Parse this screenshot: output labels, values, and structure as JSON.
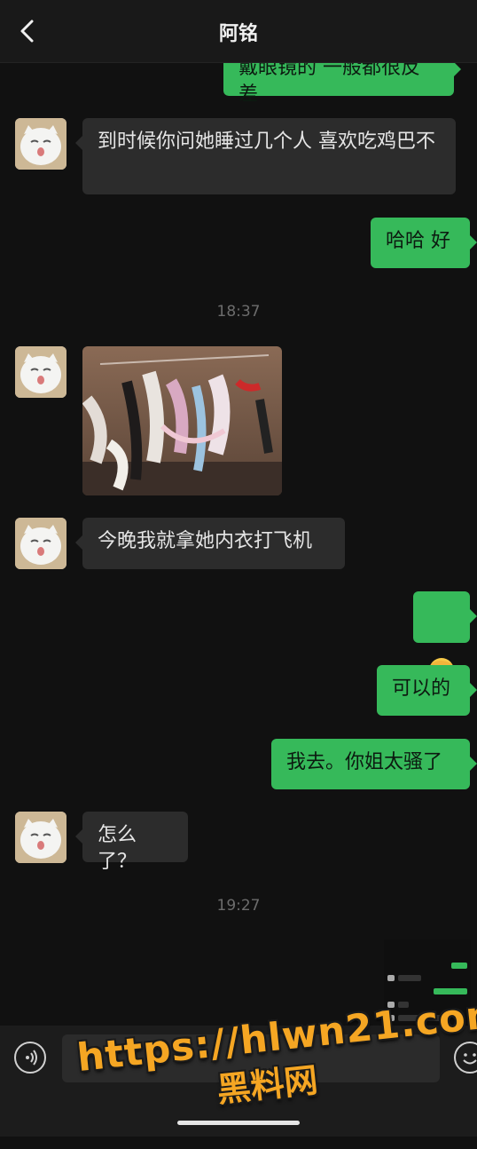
{
  "header": {
    "title": "阿铭"
  },
  "messages": [
    {
      "side": "right",
      "text": "戴眼镜的 一般都很反差"
    },
    {
      "side": "left",
      "text": "到时候你问她睡过几个人 喜欢吃鸡巴不"
    },
    {
      "side": "right",
      "text": "哈哈 好"
    },
    {
      "side": "left",
      "text": "今晚我就拿她内衣打飞机"
    },
    {
      "side": "right",
      "text": "可以的"
    },
    {
      "side": "right",
      "text": "我去。你姐太骚了"
    },
    {
      "side": "left",
      "text": "怎么了？"
    }
  ],
  "timestamps": [
    "18:37",
    "19:27"
  ],
  "watermark": {
    "url": "https://hlwn21.com",
    "name": "黑料网"
  },
  "colors": {
    "self_bubble": "#36b95a",
    "other_bubble": "#2c2c2c",
    "background": "#111111"
  }
}
